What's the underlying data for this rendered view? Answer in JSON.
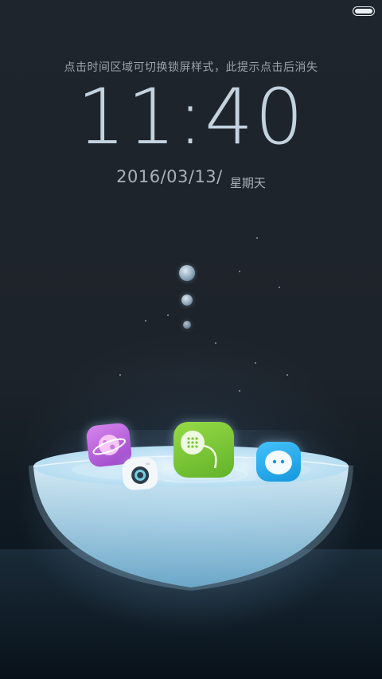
{
  "status_bar": {
    "battery_level": 1.0,
    "battery_icon": "battery-icon"
  },
  "lockscreen": {
    "hint": "点击时间区域可切换锁屏样式，此提示点击后消失",
    "time": "11:40",
    "date": "2016/03/13/",
    "weekday": "星期天"
  },
  "apps": [
    {
      "icon": "browser-planet-icon",
      "color": "#b25ad6"
    },
    {
      "icon": "camera-icon",
      "color": "#f4f7f9"
    },
    {
      "icon": "phone-icon",
      "color": "#7cc63a"
    },
    {
      "icon": "messages-icon",
      "color": "#23aef0"
    }
  ],
  "colors": {
    "background": "#1c2128",
    "text_primary": "#c9d7e4",
    "text_secondary": "#9aa4ad",
    "water": "#bfe3f5"
  }
}
